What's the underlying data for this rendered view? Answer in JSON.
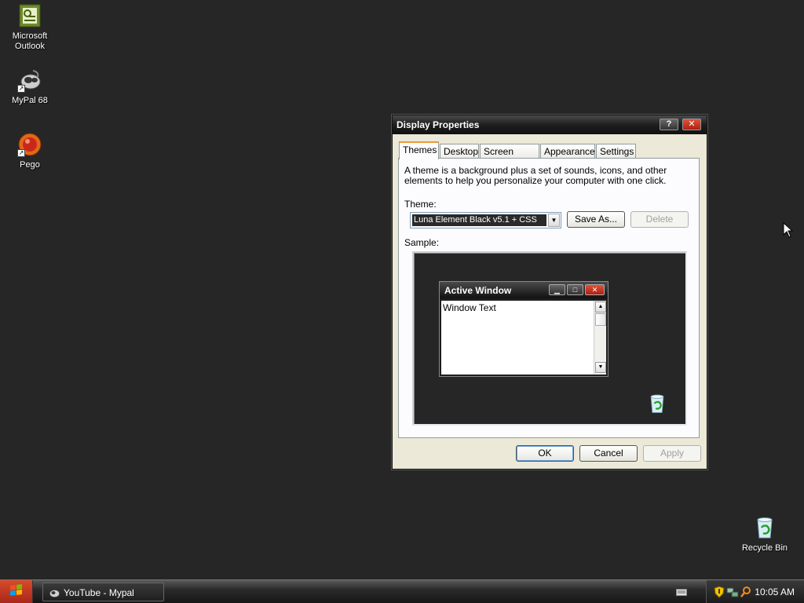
{
  "desktop": {
    "icons": [
      {
        "label": "Microsoft Outlook",
        "icon": "outlook-icon"
      },
      {
        "label": "MyPal 68",
        "icon": "mypal-icon"
      },
      {
        "label": "Pego",
        "icon": "pego-icon"
      },
      {
        "label": "Recycle Bin",
        "icon": "recycle-bin-icon"
      }
    ]
  },
  "dialog": {
    "title": "Display Properties",
    "help_glyph": "?",
    "close_glyph": "✕",
    "tabs": [
      "Themes",
      "Desktop",
      "Screen Saver",
      "Appearance",
      "Settings"
    ],
    "active_tab": "Themes",
    "description": "A theme is a background plus a set of sounds, icons, and other elements to help you personalize your computer with one click.",
    "theme_label": "Theme:",
    "theme_value": "Luna Element Black v5.1 + CSS",
    "save_as_label": "Save As...",
    "delete_label": "Delete",
    "sample_label": "Sample:",
    "sample": {
      "window_title": "Active Window",
      "window_text": "Window Text"
    },
    "ok_label": "OK",
    "cancel_label": "Cancel",
    "apply_label": "Apply"
  },
  "taskbar": {
    "task_label": "YouTube - Mypal",
    "clock": "10:05 AM"
  },
  "colors": {
    "desktop_bg": "#262626",
    "close_red": "#c8341e",
    "active_tab_accent": "#e89b3a"
  }
}
